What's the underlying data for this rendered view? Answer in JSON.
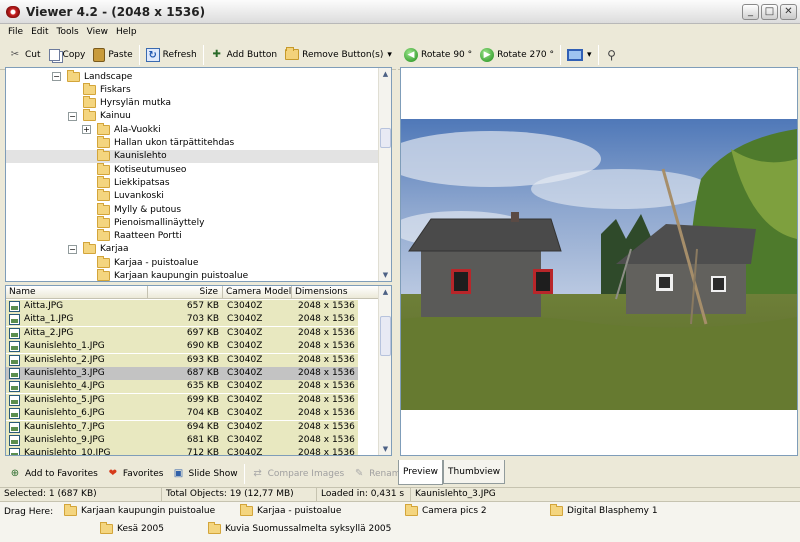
{
  "window": {
    "title": "Viewer 4.2 -  (2048 x 1536)",
    "min_btn": "_",
    "max_btn": "□",
    "close_btn": "✕"
  },
  "menu": [
    "File",
    "Edit",
    "Tools",
    "View",
    "Help"
  ],
  "toolbar_left": {
    "cut": "Cut",
    "copy": "Copy",
    "paste": "Paste",
    "refresh": "Refresh",
    "add_button": "Add Button",
    "remove_button": "Remove Button(s)",
    "dropdown": "▾",
    "filter": "✓"
  },
  "toolbar_right": {
    "rotate_left": "Rotate 90 °",
    "rotate_right": "Rotate 270 °",
    "monitor_dropdown": "▾",
    "zoom": "⚲"
  },
  "tree": [
    {
      "label": "Landscape",
      "level": 0,
      "expander": "−"
    },
    {
      "label": "Fiskars",
      "level": 1,
      "expander": ""
    },
    {
      "label": "Hyrsylän mutka",
      "level": 1,
      "expander": ""
    },
    {
      "label": "Kainuu",
      "level": 1,
      "expander": "−"
    },
    {
      "label": "Ala-Vuokki",
      "level": 2,
      "expander": "+"
    },
    {
      "label": "Hallan ukon tärpättitehdas",
      "level": 2,
      "expander": ""
    },
    {
      "label": "Kaunislehto",
      "level": 2,
      "expander": "",
      "selected": true
    },
    {
      "label": "Kotiseutumuseo",
      "level": 2,
      "expander": ""
    },
    {
      "label": "Liekkipatsas",
      "level": 2,
      "expander": ""
    },
    {
      "label": "Luvankoski",
      "level": 2,
      "expander": ""
    },
    {
      "label": "Mylly & putous",
      "level": 2,
      "expander": ""
    },
    {
      "label": "Pienoismallinäyttely",
      "level": 2,
      "expander": ""
    },
    {
      "label": "Raatteen Portti",
      "level": 2,
      "expander": ""
    },
    {
      "label": "Karjaa",
      "level": 1,
      "expander": "−"
    },
    {
      "label": "Karjaa - puistoalue",
      "level": 2,
      "expander": ""
    },
    {
      "label": "Karjaan kaupungin puistoalue",
      "level": 2,
      "expander": ""
    }
  ],
  "file_list": {
    "headers": [
      "Name",
      "Size",
      "Camera Model",
      "Dimensions"
    ],
    "rows": [
      {
        "name": "Aitta.JPG",
        "size": "657 KB",
        "model": "C3040Z",
        "dims": "2048 x 1536"
      },
      {
        "name": "Aitta_1.JPG",
        "size": "703 KB",
        "model": "C3040Z",
        "dims": "2048 x 1536"
      },
      {
        "name": "Aitta_2.JPG",
        "size": "697 KB",
        "model": "C3040Z",
        "dims": "2048 x 1536"
      },
      {
        "name": "Kaunislehto_1.JPG",
        "size": "690 KB",
        "model": "C3040Z",
        "dims": "2048 x 1536"
      },
      {
        "name": "Kaunislehto_2.JPG",
        "size": "693 KB",
        "model": "C3040Z",
        "dims": "2048 x 1536"
      },
      {
        "name": "Kaunislehto_3.JPG",
        "size": "687 KB",
        "model": "C3040Z",
        "dims": "2048 x 1536",
        "selected": true
      },
      {
        "name": "Kaunislehto_4.JPG",
        "size": "635 KB",
        "model": "C3040Z",
        "dims": "2048 x 1536"
      },
      {
        "name": "Kaunislehto_5.JPG",
        "size": "699 KB",
        "model": "C3040Z",
        "dims": "2048 x 1536"
      },
      {
        "name": "Kaunislehto_6.JPG",
        "size": "704 KB",
        "model": "C3040Z",
        "dims": "2048 x 1536"
      },
      {
        "name": "Kaunislehto_7.JPG",
        "size": "694 KB",
        "model": "C3040Z",
        "dims": "2048 x 1536"
      },
      {
        "name": "Kaunislehto_9.JPG",
        "size": "681 KB",
        "model": "C3040Z",
        "dims": "2048 x 1536"
      },
      {
        "name": "Kaunislehto_10.JPG",
        "size": "712 KB",
        "model": "C3040Z",
        "dims": "2048 x 1536"
      }
    ]
  },
  "bottom_toolbar": {
    "add_favorites": "Add to Favorites",
    "favorites": "Favorites",
    "slide_show": "Slide Show",
    "compare": "Compare Images",
    "rename": "Rename Selected"
  },
  "tabs": {
    "preview": "Preview",
    "thumbview": "Thumbview"
  },
  "status": {
    "selected": "Selected: 1 (687 KB)",
    "total": "Total Objects: 19 (12,77 MB)",
    "loaded": "Loaded in: 0,431 s",
    "filename": "Kaunislehto_3.JPG"
  },
  "drag": {
    "label": "Drag Here:",
    "folders": [
      "Karjaan kaupungin puistoalue",
      "Karjaa - puistoalue",
      "Camera pics 2",
      "Digital Blasphemy 1",
      "Kesä 2005",
      "Kuvia Suomussalmelta syksyllä 2005"
    ]
  }
}
